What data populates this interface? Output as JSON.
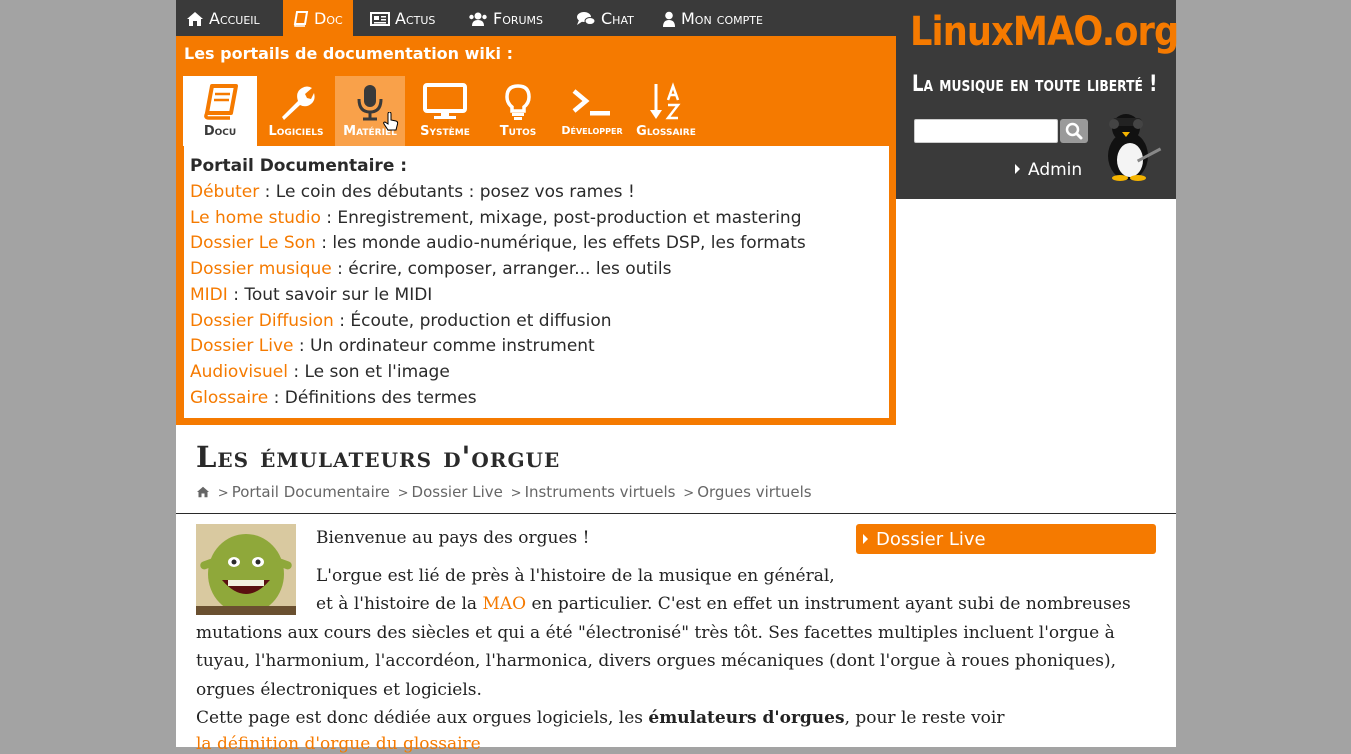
{
  "nav": {
    "items": [
      {
        "label": "Accueil",
        "icon": "home-icon"
      },
      {
        "label": "Doc",
        "icon": "book-icon"
      },
      {
        "label": "Actus",
        "icon": "newspaper-icon"
      },
      {
        "label": "Forums",
        "icon": "users-icon"
      },
      {
        "label": "Chat",
        "icon": "chat-icon"
      },
      {
        "label": "Mon compte",
        "icon": "user-icon"
      }
    ],
    "active": "Doc"
  },
  "brand": {
    "logo": "LinuxMAO.org",
    "tagline": "La musique en toute liberté !",
    "search_placeholder": "",
    "admin_label": "Admin"
  },
  "portal_panel": {
    "title": "Les portails de documentation wiki :",
    "tabs": [
      {
        "label": "Docu",
        "icon": "book-icon"
      },
      {
        "label": "Logiciels",
        "icon": "wrench-icon"
      },
      {
        "label": "Matériel",
        "icon": "microphone-icon"
      },
      {
        "label": "Système",
        "icon": "monitor-icon"
      },
      {
        "label": "Tutos",
        "icon": "lightbulb-icon"
      },
      {
        "label": "Développer",
        "icon": "terminal-icon"
      },
      {
        "label": "Glossaire",
        "icon": "sort-az-icon"
      }
    ],
    "active_tab": "Docu",
    "hover_tab": "Matériel",
    "list_title": "Portail Documentaire :",
    "links": [
      {
        "link": "Débuter",
        "desc": " : Le coin des débutants : posez vos rames !"
      },
      {
        "link": "Le home studio",
        "desc": " : Enregistrement, mixage, post-production et mastering"
      },
      {
        "link": "Dossier Le Son",
        "desc": " : les monde audio-numérique, les effets DSP, les formats"
      },
      {
        "link": "Dossier musique",
        "desc": " : écrire, composer, arranger... les outils"
      },
      {
        "link": "MIDI",
        "desc": " : Tout savoir sur le MIDI"
      },
      {
        "link": "Dossier Diffusion",
        "desc": " : Écoute, production et diffusion"
      },
      {
        "link": "Dossier Live",
        "desc": " : Un ordinateur comme instrument"
      },
      {
        "link": "Audiovisuel",
        "desc": " : Le son et l'image"
      },
      {
        "link": "Glossaire",
        "desc": " : Définitions des termes"
      }
    ]
  },
  "article": {
    "title": "Les émulateurs d'orgue",
    "breadcrumb": [
      "Portail Documentaire",
      "Dossier Live",
      "Instruments virtuels",
      "Orgues virtuels"
    ],
    "sidebox_label": "Dossier Live",
    "intro": "Bienvenue au pays des orgues !",
    "p1_line1": "L'orgue est lié de près à l'histoire de la musique en général,",
    "p1_line2_pre": "et à l'histoire de la ",
    "p1_line2_link": "MAO",
    "p1_line2_post": " en particulier. C'est en effet un instrument ayant subi de nombreuses",
    "p1_line3": "mutations aux cours des siècles et qui a été \"électronisé\" très tôt. Ses facettes multiples incluent l'orgue à",
    "p1_line4": "tuyau, l'harmonium, l'accordéon, l'harmonica, divers orgues mécaniques (dont l'orgue à roues phoniques),",
    "p1_line5": "orgues électroniques et logiciels.",
    "p2_pre": "Cette page est donc dédiée aux orgues logiciels, les ",
    "p2_bold": "émulateurs d'orgues",
    "p2_post": ", pour le reste voir",
    "p2_link": "la définition d'orgue du glossaire"
  },
  "colors": {
    "accent": "#f57a00",
    "dark": "#3a3a3a",
    "background": "#a3a3a3"
  }
}
